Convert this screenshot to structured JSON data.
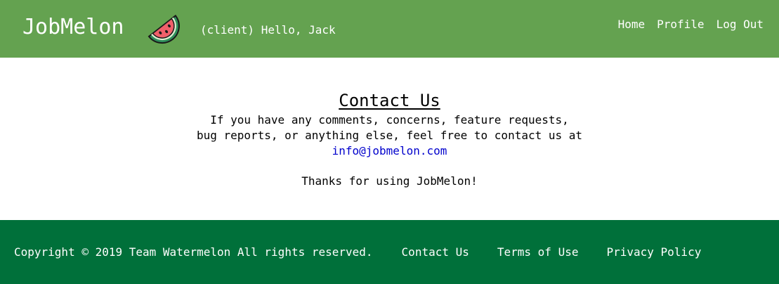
{
  "header": {
    "brand": "JobMelon",
    "logo_icon": "watermelon-icon",
    "greeting": "(client) Hello, Jack",
    "nav": {
      "home": "Home",
      "profile": "Profile",
      "logout": "Log Out"
    }
  },
  "main": {
    "title": "Contact Us",
    "line1": "If you have any comments, concerns, feature requests,",
    "line2": "bug reports, or anything else, feel free to contact us at",
    "email": "info@jobmelon.com",
    "thanks": "Thanks for using JobMelon!"
  },
  "footer": {
    "copyright": "Copyright © 2019 Team Watermelon All rights reserved.",
    "contact": "Contact Us",
    "terms": "Terms of Use",
    "privacy": "Privacy Policy"
  },
  "colors": {
    "header_bg": "#64a250",
    "footer_bg": "#00703a",
    "link": "#0000cc"
  }
}
